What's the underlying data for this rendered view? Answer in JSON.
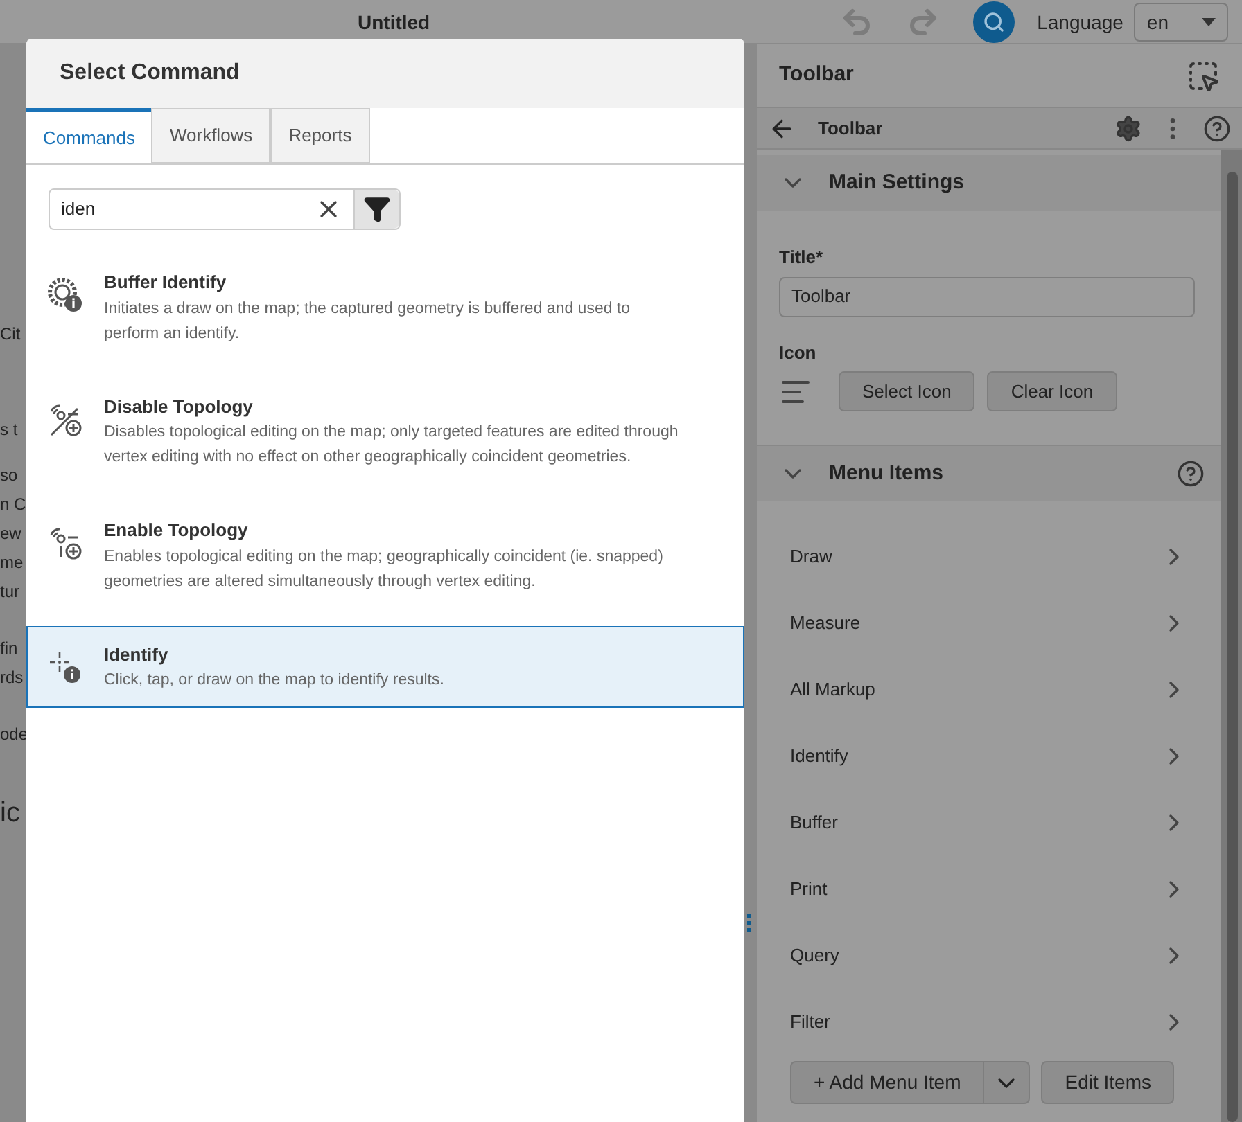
{
  "app_bar": {
    "title": "Untitled",
    "language_label": "Language",
    "language_value": "en"
  },
  "background_fragments": [
    "Cit",
    "s t",
    "so",
    "n C",
    "ew",
    "me",
    "tur",
    "fin",
    "rds",
    "ode",
    "ic"
  ],
  "dialog": {
    "title": "Select Command",
    "tabs": [
      {
        "label": "Commands",
        "selected": true
      },
      {
        "label": "Workflows",
        "selected": false
      },
      {
        "label": "Reports",
        "selected": false
      }
    ],
    "search": {
      "value": "iden"
    },
    "commands": [
      {
        "title": "Buffer Identify",
        "description": "Initiates a draw on the map; the captured geometry is buffered and used to perform an identify.",
        "selected": false
      },
      {
        "title": "Disable Topology",
        "description": "Disables topological editing on the map; only targeted features are edited through vertex editing with no effect on other geographically coincident geometries.",
        "selected": false
      },
      {
        "title": "Enable Topology",
        "description": "Enables topological editing on the map; geographically coincident (ie. snapped) geometries are altered simultaneously through vertex editing.",
        "selected": false
      },
      {
        "title": "Identify",
        "description": "Click, tap, or draw on the map to identify results.",
        "selected": true
      }
    ]
  },
  "panel": {
    "title": "Toolbar",
    "breadcrumb": "Toolbar",
    "main_settings": {
      "heading": "Main Settings",
      "expanded": true,
      "title_label": "Title*",
      "title_value": "Toolbar",
      "icon_label": "Icon",
      "buttons": [
        "Select Icon",
        "Clear Icon"
      ]
    },
    "menu_items": {
      "heading": "Menu Items",
      "expanded": true,
      "items": [
        "Draw",
        "Measure",
        "All Markup",
        "Identify",
        "Buffer",
        "Print",
        "Query",
        "Filter"
      ],
      "add_button": "+ Add Menu Item",
      "edit_button": "Edit Items"
    }
  }
}
